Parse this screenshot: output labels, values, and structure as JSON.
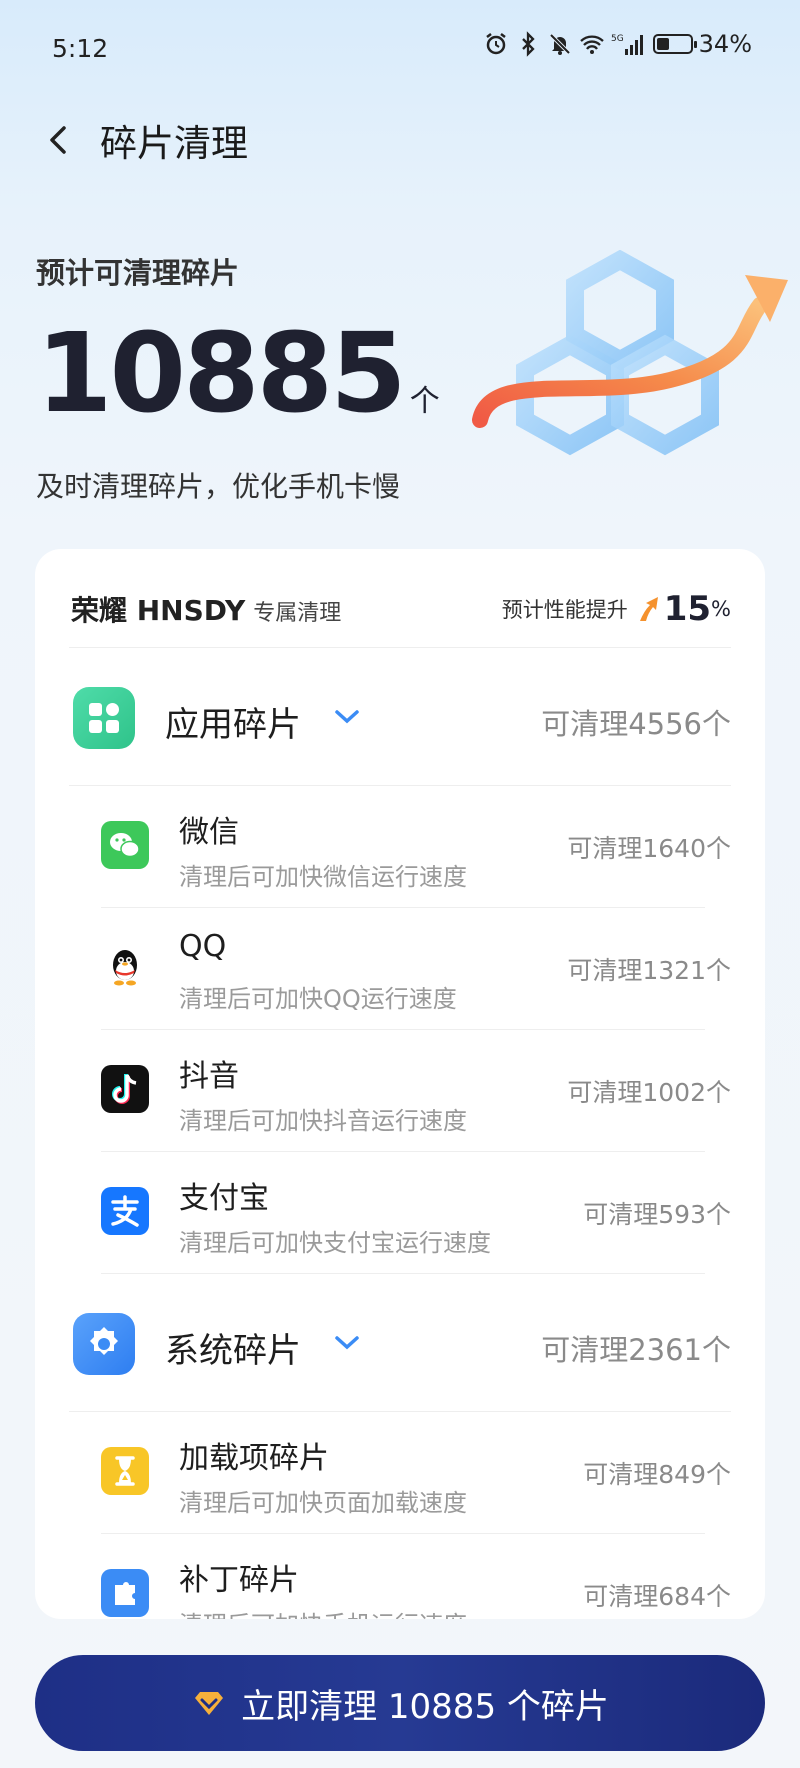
{
  "status": {
    "time": "5:12",
    "battery": "34%",
    "battery_level": 0.34,
    "network": "5G"
  },
  "header": {
    "title": "碎片清理"
  },
  "hero": {
    "label": "预计可清理碎片",
    "count": "10885",
    "unit": "个",
    "subtitle": "及时清理碎片，优化手机卡慢"
  },
  "card": {
    "brand": "荣耀 HNSDY",
    "brand_sub": "专属清理",
    "perf_label": "预计性能提升",
    "perf_value": "15",
    "perf_unit": "%"
  },
  "groups": [
    {
      "title": "应用碎片",
      "count": "可清理4556个",
      "icon": "apps-grid-icon",
      "color": "#3fd09a",
      "items": [
        {
          "title": "微信",
          "desc": "清理后可加快微信运行速度",
          "count": "可清理1640个",
          "icon": "wechat-icon"
        },
        {
          "title": "QQ",
          "desc": "清理后可加快QQ运行速度",
          "count": "可清理1321个",
          "icon": "qq-icon"
        },
        {
          "title": "抖音",
          "desc": "清理后可加快抖音运行速度",
          "count": "可清理1002个",
          "icon": "douyin-icon"
        },
        {
          "title": "支付宝",
          "desc": "清理后可加快支付宝运行速度",
          "count": "可清理593个",
          "icon": "alipay-icon"
        }
      ]
    },
    {
      "title": "系统碎片",
      "count": "可清理2361个",
      "icon": "system-gear-icon",
      "color": "#3b8cf5",
      "items": [
        {
          "title": "加载项碎片",
          "desc": "清理后可加快页面加载速度",
          "count": "可清理849个",
          "icon": "hourglass-icon"
        },
        {
          "title": "补丁碎片",
          "desc": "清理后可加快手机运行速度",
          "count": "可清理684个",
          "icon": "patch-icon"
        }
      ]
    }
  ],
  "cta": {
    "label": "立即清理 10885 个碎片"
  },
  "colors": {
    "accent": "#3b8cf5",
    "cta": "#1e2f86",
    "hero_text": "#1f2130"
  }
}
